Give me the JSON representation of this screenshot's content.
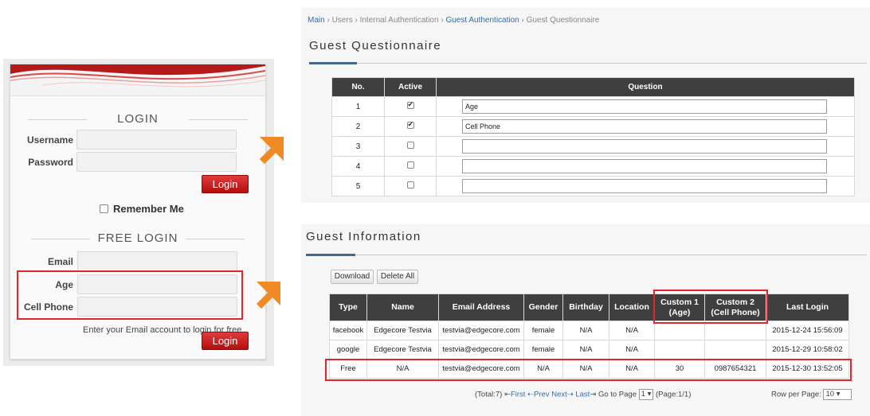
{
  "login": {
    "title": "LOGIN",
    "username_label": "Username",
    "password_label": "Password",
    "login_button": "Login",
    "remember_label": "Remember Me",
    "free_title": "FREE LOGIN",
    "email_label": "Email",
    "age_label": "Age",
    "phone_label": "Cell Phone",
    "hint": "Enter your Email account to login for free.",
    "free_login_button": "Login"
  },
  "breadcrumb": {
    "main": "Main",
    "users": "Users",
    "internal": "Internal Authentication",
    "guest_auth": "Guest Authentication",
    "current": "Guest Questionnaire",
    "sep": " › "
  },
  "questionnaire": {
    "title": "Guest Questionnaire",
    "headers": [
      "No.",
      "Active",
      "Question"
    ],
    "rows": [
      {
        "no": "1",
        "active": true,
        "question": "Age"
      },
      {
        "no": "2",
        "active": true,
        "question": "Cell Phone"
      },
      {
        "no": "3",
        "active": false,
        "question": ""
      },
      {
        "no": "4",
        "active": false,
        "question": ""
      },
      {
        "no": "5",
        "active": false,
        "question": ""
      }
    ]
  },
  "guest_info": {
    "title": "Guest Information",
    "download_button": "Download",
    "delete_all_button": "Delete All",
    "headers": [
      "Type",
      "Name",
      "Email Address",
      "Gender",
      "Birthday",
      "Location",
      "Custom 1\n(Age)",
      "Custom 2\n(Cell Phone)",
      "Last Login"
    ],
    "rows": [
      [
        "facebook",
        "Edgecore Testvia",
        "testvia@edgecore.com",
        "female",
        "N/A",
        "N/A",
        "",
        "",
        "2015-12-24 15:56:09"
      ],
      [
        "google",
        "Edgecore Testvia",
        "testvia@edgecore.com",
        "female",
        "N/A",
        "N/A",
        "",
        "",
        "2015-12-29 10:58:02"
      ],
      [
        "Free",
        "N/A",
        "testvia@edgecore.com",
        "N/A",
        "N/A",
        "N/A",
        "30",
        "0987654321",
        "2015-12-30 13:52:05"
      ]
    ],
    "pager": {
      "total": "(Total:7)",
      "first": "First",
      "prev": "Prev",
      "next": "Next",
      "last": "Last",
      "goto_label": "Go to Page",
      "page_value": "1",
      "page_info": "(Page:1/1)",
      "rows_label": "Row per Page:",
      "rows_value": "10"
    }
  },
  "colors": {
    "accent_red": "#e0262a",
    "arrow_orange": "#f08a24",
    "header_dark": "#3f3f3f",
    "link_blue": "#2a6fb3"
  }
}
